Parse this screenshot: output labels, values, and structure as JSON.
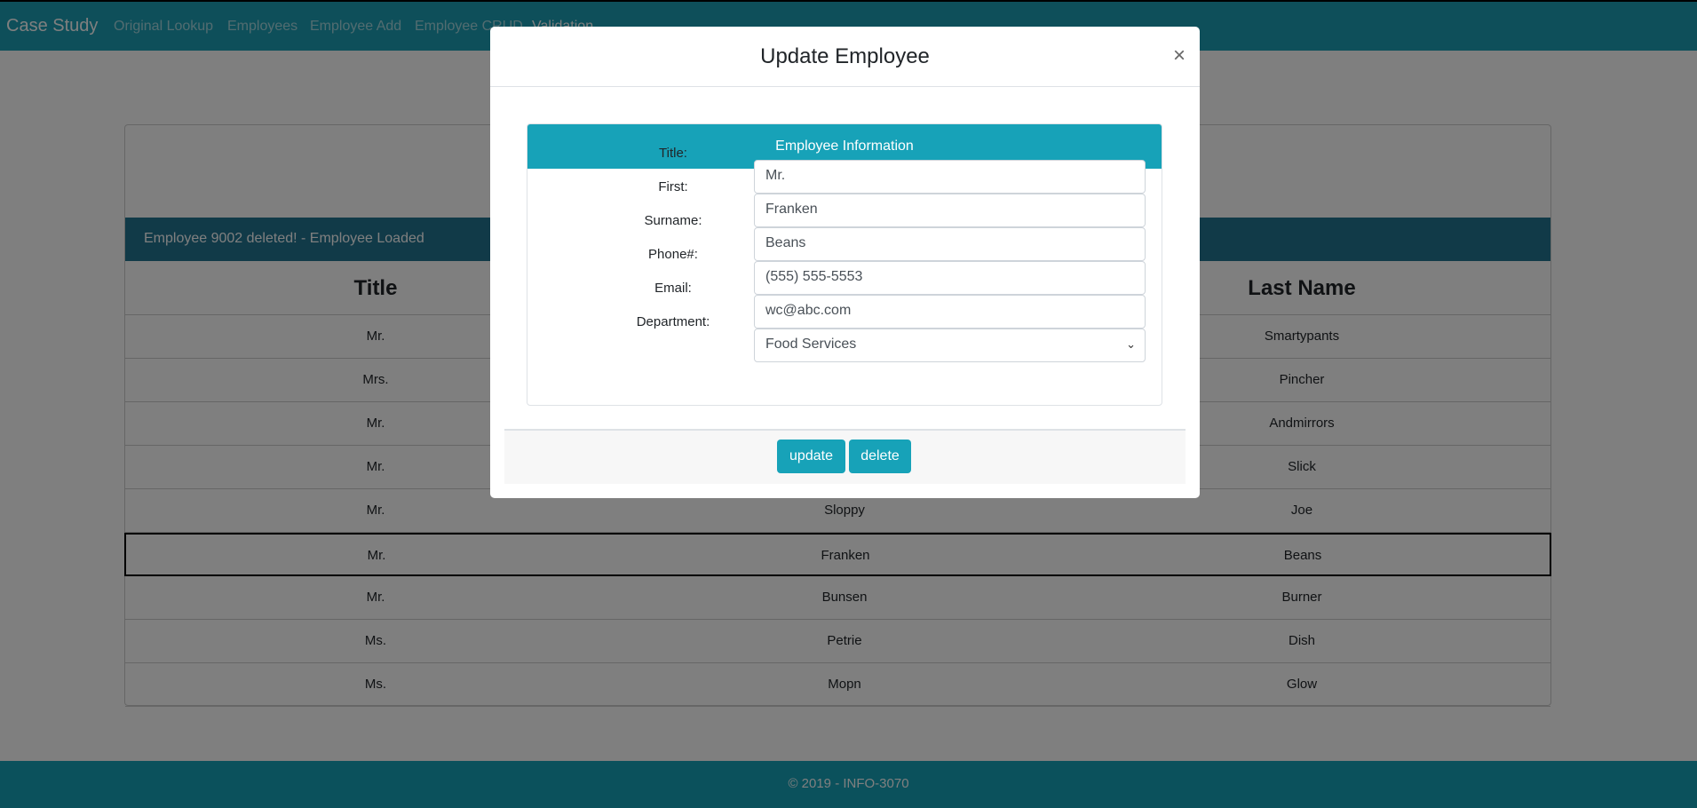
{
  "nav": {
    "brand": "Case Study",
    "links": [
      "Original Lookup",
      "Employees",
      "Employee Add",
      "Employee CRUD",
      "Validation"
    ]
  },
  "status": "Employee 9002 deleted! - Employee Loaded",
  "table": {
    "headers": [
      "Title",
      "",
      "Last Name"
    ],
    "rows": [
      [
        "Mr.",
        "",
        "Smartypants"
      ],
      [
        "Mrs.",
        "",
        "Pincher"
      ],
      [
        "Mr.",
        "",
        "Andmirrors"
      ],
      [
        "Mr.",
        "",
        "Slick"
      ],
      [
        "Mr.",
        "Sloppy",
        "Joe"
      ],
      [
        "Mr.",
        "Franken",
        "Beans"
      ],
      [
        "Mr.",
        "Bunsen",
        "Burner"
      ],
      [
        "Ms.",
        "Petrie",
        "Dish"
      ],
      [
        "Ms.",
        "Mopn",
        "Glow"
      ]
    ],
    "selected_row": 5
  },
  "footer": "© 2019 - INFO-3070",
  "modal": {
    "title": "Update Employee",
    "close": "×",
    "card_title": "Employee Information",
    "fields": [
      {
        "label": "Title:",
        "value": "Mr."
      },
      {
        "label": "First:",
        "value": "Franken"
      },
      {
        "label": "Surname:",
        "value": "Beans"
      },
      {
        "label": "Phone#:",
        "value": "(555) 555-5553"
      },
      {
        "label": "Email:",
        "value": "wc@abc.com"
      },
      {
        "label": "Department:",
        "value": "Food Services"
      }
    ],
    "update_label": "update",
    "delete_label": "delete"
  },
  "colors": {
    "accent": "#17a2b8"
  }
}
